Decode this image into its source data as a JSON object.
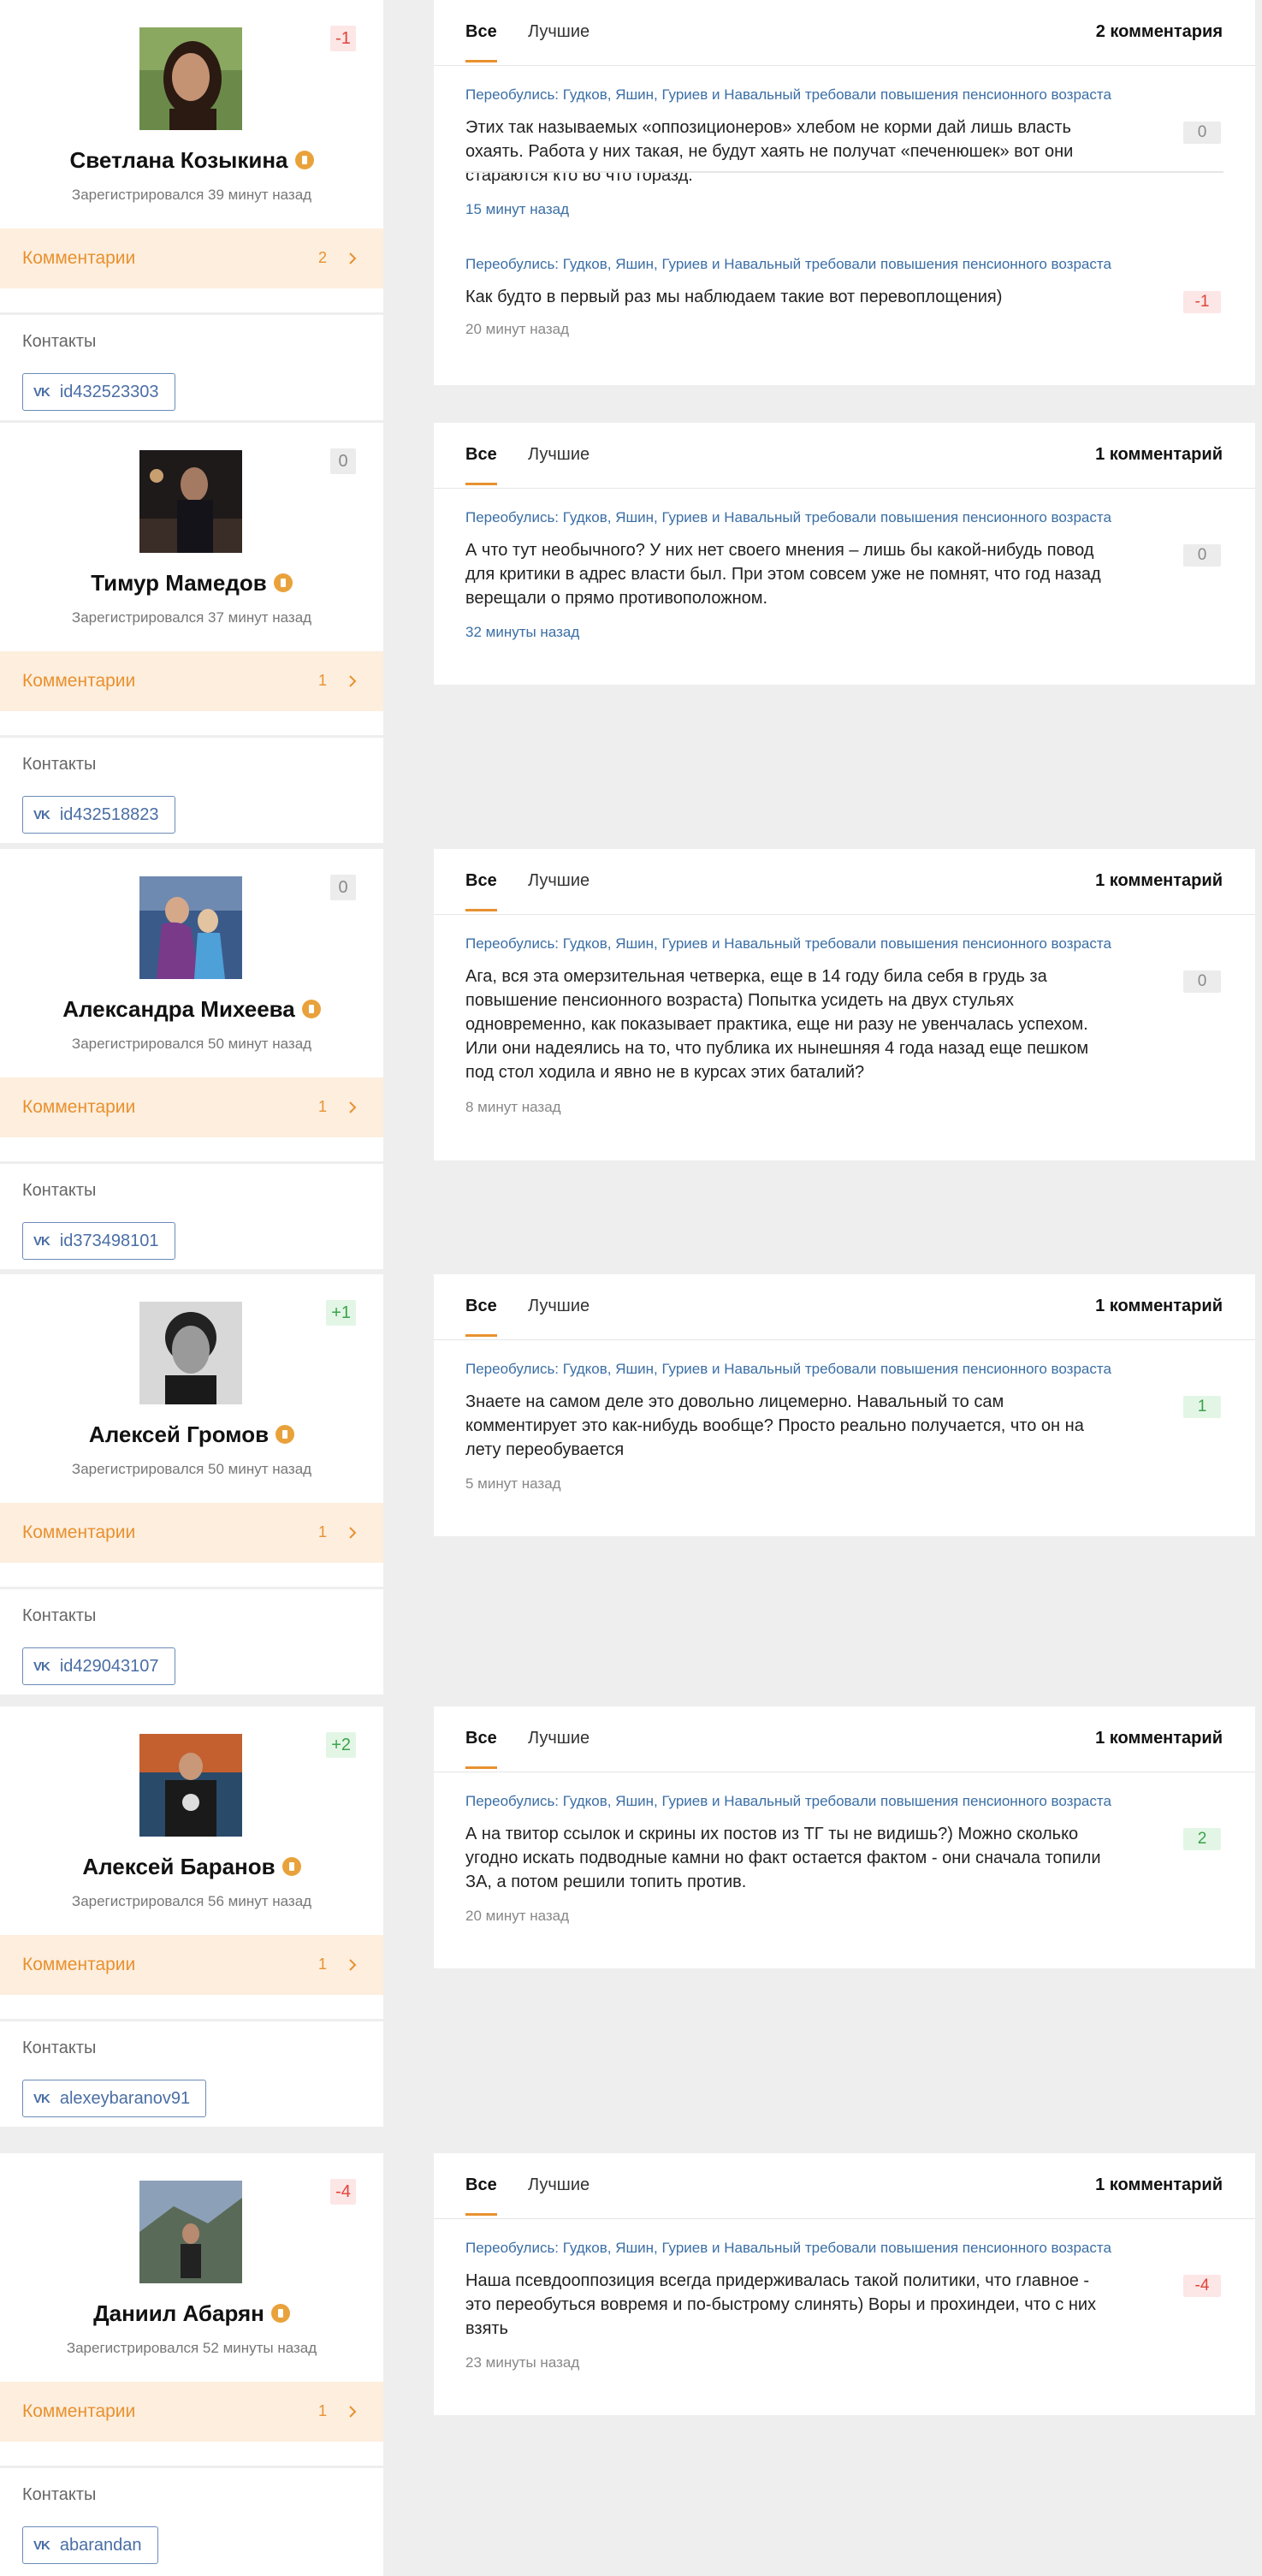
{
  "colors": {
    "accent": "#e8912f",
    "link": "#3a6ea5",
    "negative": "#e0443a",
    "positive": "#3aa34a"
  },
  "users": [
    {
      "name": "Светлана Козыкина",
      "registered": "Зарегистрировался 39 минут назад",
      "rating": "-1",
      "comments_label": "Комментарии",
      "comments_count": "2",
      "contacts_title": "Контакты",
      "vk_icon": "vk-icon",
      "vk_id": "id432523303",
      "tabs": {
        "all": "Все",
        "best": "Лучшие",
        "count": "2 комментария"
      },
      "comments": [
        {
          "post": "Переобулись: Гудков, Яшин, Гуриев и Навальный требовали повышения пенсионного возраста",
          "lines": [
            "Этих так называемых «оппозиционеров» хлебом не корми дай лишь власть",
            "охаять. Работа у них такая, не будут хаять не получат «печенюшек» вот они",
            "стараются кто во что горазд."
          ],
          "time": "15 минут назад",
          "score": "0"
        },
        {
          "post": "Переобулись: Гудков, Яшин, Гуриев и Навальный требовали повышения пенсионного возраста",
          "lines": [
            "Как будто в первый раз мы наблюдаем такие вот перевоплощения)"
          ],
          "time": "20 минут назад",
          "score": "-1"
        }
      ]
    },
    {
      "name": "Тимур Мамедов",
      "registered": "Зарегистрировался 37 минут назад",
      "rating": "0",
      "comments_label": "Комментарии",
      "comments_count": "1",
      "contacts_title": "Контакты",
      "vk_id": "id432518823",
      "tabs": {
        "all": "Все",
        "best": "Лучшие",
        "count": "1 комментарий"
      },
      "comments": [
        {
          "post": "Переобулись: Гудков, Яшин, Гуриев и Навальный требовали повышения пенсионного возраста",
          "lines": [
            "А что тут необычного? У них нет своего мнения – лишь бы какой-нибудь повод",
            "для критики в адрес власти был. При этом совсем уже не помнят, что год назад",
            "верещали о прямо противоположном."
          ],
          "time": "32 минуты назад",
          "score": "0"
        }
      ]
    },
    {
      "name": "Александра Михеева",
      "registered": "Зарегистрировался 50 минут назад",
      "rating": "0",
      "comments_label": "Комментарии",
      "comments_count": "1",
      "contacts_title": "Контакты",
      "vk_id": "id373498101",
      "tabs": {
        "all": "Все",
        "best": "Лучшие",
        "count": "1 комментарий"
      },
      "comments": [
        {
          "post": "Переобулись: Гудков, Яшин, Гуриев и Навальный требовали повышения пенсионного возраста",
          "lines": [
            "Ага, вся эта омерзительная четверка, еще в 14 году била себя в грудь за",
            "повышение пенсионного возраста) Попытка усидеть на двух стульях",
            "одновременно, как показывает практика, еще ни разу не увенчалась успехом.",
            "Или они надеялись на то, что публика их нынешняя 4 года назад еще пешком",
            "под стол ходила и явно не в курсах этих баталий?"
          ],
          "time": "8 минут назад",
          "score": "0"
        }
      ]
    },
    {
      "name": "Алексей Громов",
      "registered": "Зарегистрировался 50 минут назад",
      "rating": "+1",
      "comments_label": "Комментарии",
      "comments_count": "1",
      "contacts_title": "Контакты",
      "vk_id": "id429043107",
      "tabs": {
        "all": "Все",
        "best": "Лучшие",
        "count": "1 комментарий"
      },
      "comments": [
        {
          "post": "Переобулись: Гудков, Яшин, Гуриев и Навальный требовали повышения пенсионного возраста",
          "lines": [
            "Знаете на самом деле это довольно лицемерно. Навальный то сам",
            "комментирует это как-нибудь вообще? Просто реально получается, что он на",
            "лету переобувается"
          ],
          "time": "5 минут назад",
          "score": "1"
        }
      ]
    },
    {
      "name": "Алексей Баранов",
      "registered": "Зарегистрировался 56 минут назад",
      "rating": "+2",
      "comments_label": "Комментарии",
      "comments_count": "1",
      "contacts_title": "Контакты",
      "vk_id": "alexeybaranov91",
      "tabs": {
        "all": "Все",
        "best": "Лучшие",
        "count": "1 комментарий"
      },
      "comments": [
        {
          "post": "Переобулись: Гудков, Яшин, Гуриев и Навальный требовали повышения пенсионного возраста",
          "lines": [
            "А на твитор ссылок и скрины их постов из ТГ ты не видишь?) Можно сколько",
            "угодно искать подводные камни но факт остается фактом - они сначала топили",
            "ЗА, а потом решили топить против."
          ],
          "time": "20 минут назад",
          "score": "2"
        }
      ]
    },
    {
      "name": "Даниил Абарян",
      "registered": "Зарегистрировался 52 минуты назад",
      "rating": "-4",
      "comments_label": "Комментарии",
      "comments_count": "1",
      "contacts_title": "Контакты",
      "vk_id": "abarandan",
      "tabs": {
        "all": "Все",
        "best": "Лучшие",
        "count": "1 комментарий"
      },
      "comments": [
        {
          "post": "Переобулись: Гудков, Яшин, Гуриев и Навальный требовали повышения пенсионного возраста",
          "lines": [
            "Наша псевдооппозиция всегда придерживалась такой политики, что главное -",
            "это переобуться вовремя и по-быстрому слинять) Воры и прохиндеи, что с них",
            "взять"
          ],
          "time": "23 минуты назад",
          "score": "-4"
        }
      ]
    }
  ]
}
